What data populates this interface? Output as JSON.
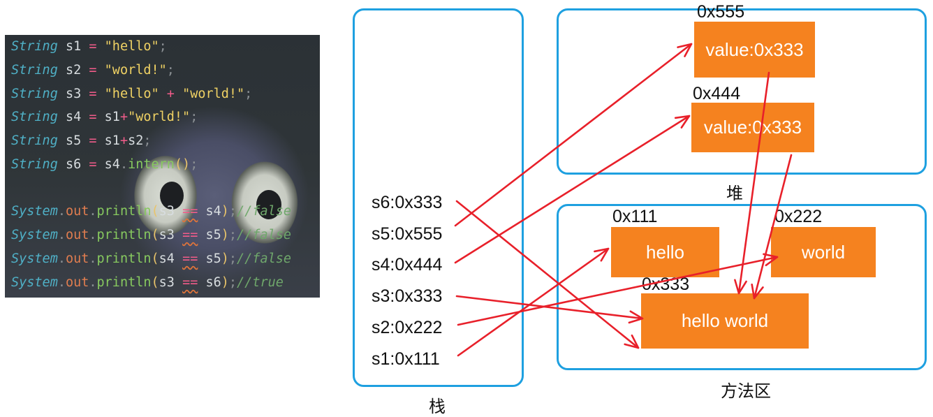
{
  "code": {
    "lines": [
      [
        {
          "t": "String",
          "c": "type"
        },
        {
          "t": " s1 ",
          "c": "var"
        },
        {
          "t": "=",
          "c": "op"
        },
        {
          "t": " ",
          "c": "var"
        },
        {
          "t": "\"hello\"",
          "c": "str"
        },
        {
          "t": ";",
          "c": "punc"
        }
      ],
      [
        {
          "t": "String",
          "c": "type"
        },
        {
          "t": " s2 ",
          "c": "var"
        },
        {
          "t": "=",
          "c": "op"
        },
        {
          "t": " ",
          "c": "var"
        },
        {
          "t": "\"world!\"",
          "c": "str"
        },
        {
          "t": ";",
          "c": "punc"
        }
      ],
      [
        {
          "t": "String",
          "c": "type"
        },
        {
          "t": " s3 ",
          "c": "var"
        },
        {
          "t": "=",
          "c": "op"
        },
        {
          "t": " ",
          "c": "var"
        },
        {
          "t": "\"hello\"",
          "c": "str"
        },
        {
          "t": " ",
          "c": "var"
        },
        {
          "t": "+",
          "c": "op"
        },
        {
          "t": " ",
          "c": "var"
        },
        {
          "t": "\"world!\"",
          "c": "str"
        },
        {
          "t": ";",
          "c": "punc"
        }
      ],
      [
        {
          "t": "String",
          "c": "type"
        },
        {
          "t": " s4 ",
          "c": "var"
        },
        {
          "t": "=",
          "c": "op"
        },
        {
          "t": " s1",
          "c": "var"
        },
        {
          "t": "+",
          "c": "op"
        },
        {
          "t": "\"world!\"",
          "c": "str"
        },
        {
          "t": ";",
          "c": "punc"
        }
      ],
      [
        {
          "t": "String",
          "c": "type"
        },
        {
          "t": " s5 ",
          "c": "var"
        },
        {
          "t": "=",
          "c": "op"
        },
        {
          "t": " s1",
          "c": "var"
        },
        {
          "t": "+",
          "c": "op"
        },
        {
          "t": "s2",
          "c": "var"
        },
        {
          "t": ";",
          "c": "punc"
        }
      ],
      [
        {
          "t": "String",
          "c": "type"
        },
        {
          "t": " s6 ",
          "c": "var"
        },
        {
          "t": "=",
          "c": "op"
        },
        {
          "t": " s4",
          "c": "var"
        },
        {
          "t": ".",
          "c": "punc"
        },
        {
          "t": "intern",
          "c": "method"
        },
        {
          "t": "()",
          "c": "paren"
        },
        {
          "t": ";",
          "c": "punc"
        }
      ],
      [],
      [
        {
          "t": "System",
          "c": "type"
        },
        {
          "t": ".",
          "c": "punc"
        },
        {
          "t": "out",
          "c": "field"
        },
        {
          "t": ".",
          "c": "punc"
        },
        {
          "t": "println",
          "c": "method"
        },
        {
          "t": "(",
          "c": "paren"
        },
        {
          "t": "s3 ",
          "c": "var"
        },
        {
          "t": "==",
          "c": "op warn"
        },
        {
          "t": " s4",
          "c": "var"
        },
        {
          "t": ")",
          "c": "paren"
        },
        {
          "t": ";",
          "c": "punc"
        },
        {
          "t": "//false",
          "c": "cmt"
        }
      ],
      [
        {
          "t": "System",
          "c": "type"
        },
        {
          "t": ".",
          "c": "punc"
        },
        {
          "t": "out",
          "c": "field"
        },
        {
          "t": ".",
          "c": "punc"
        },
        {
          "t": "println",
          "c": "method"
        },
        {
          "t": "(",
          "c": "paren"
        },
        {
          "t": "s3 ",
          "c": "var"
        },
        {
          "t": "==",
          "c": "op warn"
        },
        {
          "t": " s5",
          "c": "var"
        },
        {
          "t": ")",
          "c": "paren"
        },
        {
          "t": ";",
          "c": "punc"
        },
        {
          "t": "//false",
          "c": "cmt"
        }
      ],
      [
        {
          "t": "System",
          "c": "type"
        },
        {
          "t": ".",
          "c": "punc"
        },
        {
          "t": "out",
          "c": "field"
        },
        {
          "t": ".",
          "c": "punc"
        },
        {
          "t": "println",
          "c": "method"
        },
        {
          "t": "(",
          "c": "paren"
        },
        {
          "t": "s4 ",
          "c": "var"
        },
        {
          "t": "==",
          "c": "op warn"
        },
        {
          "t": " s5",
          "c": "var"
        },
        {
          "t": ")",
          "c": "paren"
        },
        {
          "t": ";",
          "c": "punc"
        },
        {
          "t": "//false",
          "c": "cmt"
        }
      ],
      [
        {
          "t": "System",
          "c": "type"
        },
        {
          "t": ".",
          "c": "punc"
        },
        {
          "t": "out",
          "c": "field"
        },
        {
          "t": ".",
          "c": "punc"
        },
        {
          "t": "println",
          "c": "method"
        },
        {
          "t": "(",
          "c": "paren"
        },
        {
          "t": "s3 ",
          "c": "var"
        },
        {
          "t": "==",
          "c": "op warn"
        },
        {
          "t": " s6",
          "c": "var"
        },
        {
          "t": ")",
          "c": "paren"
        },
        {
          "t": ";",
          "c": "punc"
        },
        {
          "t": "//true",
          "c": "cmt"
        }
      ]
    ]
  },
  "diagram": {
    "stack": {
      "label": "栈",
      "items": [
        "s6:0x333",
        "s5:0x555",
        "s4:0x444",
        "s3:0x333",
        "s2:0x222",
        "s1:0x111"
      ]
    },
    "heap": {
      "label": "堆",
      "objects": [
        {
          "address": "0x555",
          "text": "value:0x333"
        },
        {
          "address": "0x444",
          "text": "value:0x333"
        }
      ]
    },
    "method_area": {
      "label": "方法区",
      "objects": [
        {
          "address": "0x111",
          "text": "hello"
        },
        {
          "address": "0x222",
          "text": "world"
        },
        {
          "address": "0x333",
          "text": "hello world"
        }
      ]
    },
    "arrow_color": "#e8202a",
    "border_color": "#1ea0e0",
    "box_color": "#f5821f"
  }
}
